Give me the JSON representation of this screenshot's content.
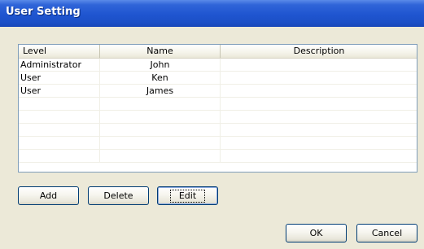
{
  "window": {
    "title": "User Setting"
  },
  "table": {
    "columns": [
      "Level",
      "Name",
      "Description"
    ],
    "rows": [
      {
        "level": "Administrator",
        "name": "John",
        "description": ""
      },
      {
        "level": "User",
        "name": "Ken",
        "description": ""
      },
      {
        "level": "User",
        "name": "James",
        "description": ""
      },
      {
        "level": "",
        "name": "",
        "description": ""
      },
      {
        "level": "",
        "name": "",
        "description": ""
      },
      {
        "level": "",
        "name": "",
        "description": ""
      },
      {
        "level": "",
        "name": "",
        "description": ""
      },
      {
        "level": "",
        "name": "",
        "description": ""
      }
    ]
  },
  "buttons": {
    "add": "Add",
    "delete": "Delete",
    "edit": "Edit",
    "ok": "OK",
    "cancel": "Cancel"
  }
}
